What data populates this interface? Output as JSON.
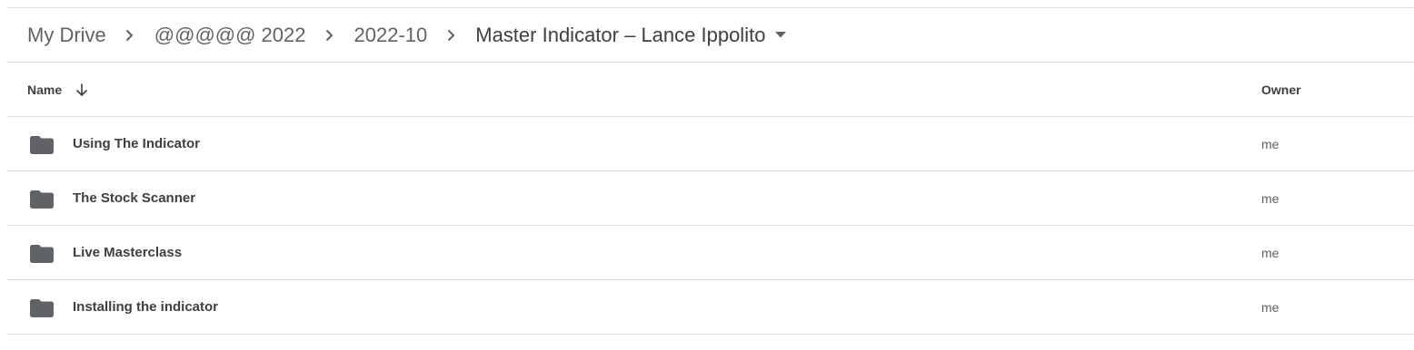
{
  "breadcrumb": {
    "items": [
      {
        "label": "My Drive"
      },
      {
        "label": "@@@@@ 2022"
      },
      {
        "label": "2022-10"
      }
    ],
    "current": "Master Indicator – Lance Ippolito"
  },
  "table": {
    "columns": {
      "name": "Name",
      "owner": "Owner"
    },
    "sort": "name-descending",
    "rows": [
      {
        "name": "Using The Indicator",
        "owner": "me",
        "icon": "folder-icon"
      },
      {
        "name": "The Stock Scanner",
        "owner": "me",
        "icon": "folder-icon"
      },
      {
        "name": "Live Masterclass",
        "owner": "me",
        "icon": "folder-icon"
      },
      {
        "name": "Installing the indicator",
        "owner": "me",
        "icon": "folder-icon"
      }
    ]
  },
  "colors": {
    "divider": "#dadce0",
    "text_primary": "#3c4043",
    "text_secondary": "#5f6368",
    "folder": "#5f6368"
  }
}
